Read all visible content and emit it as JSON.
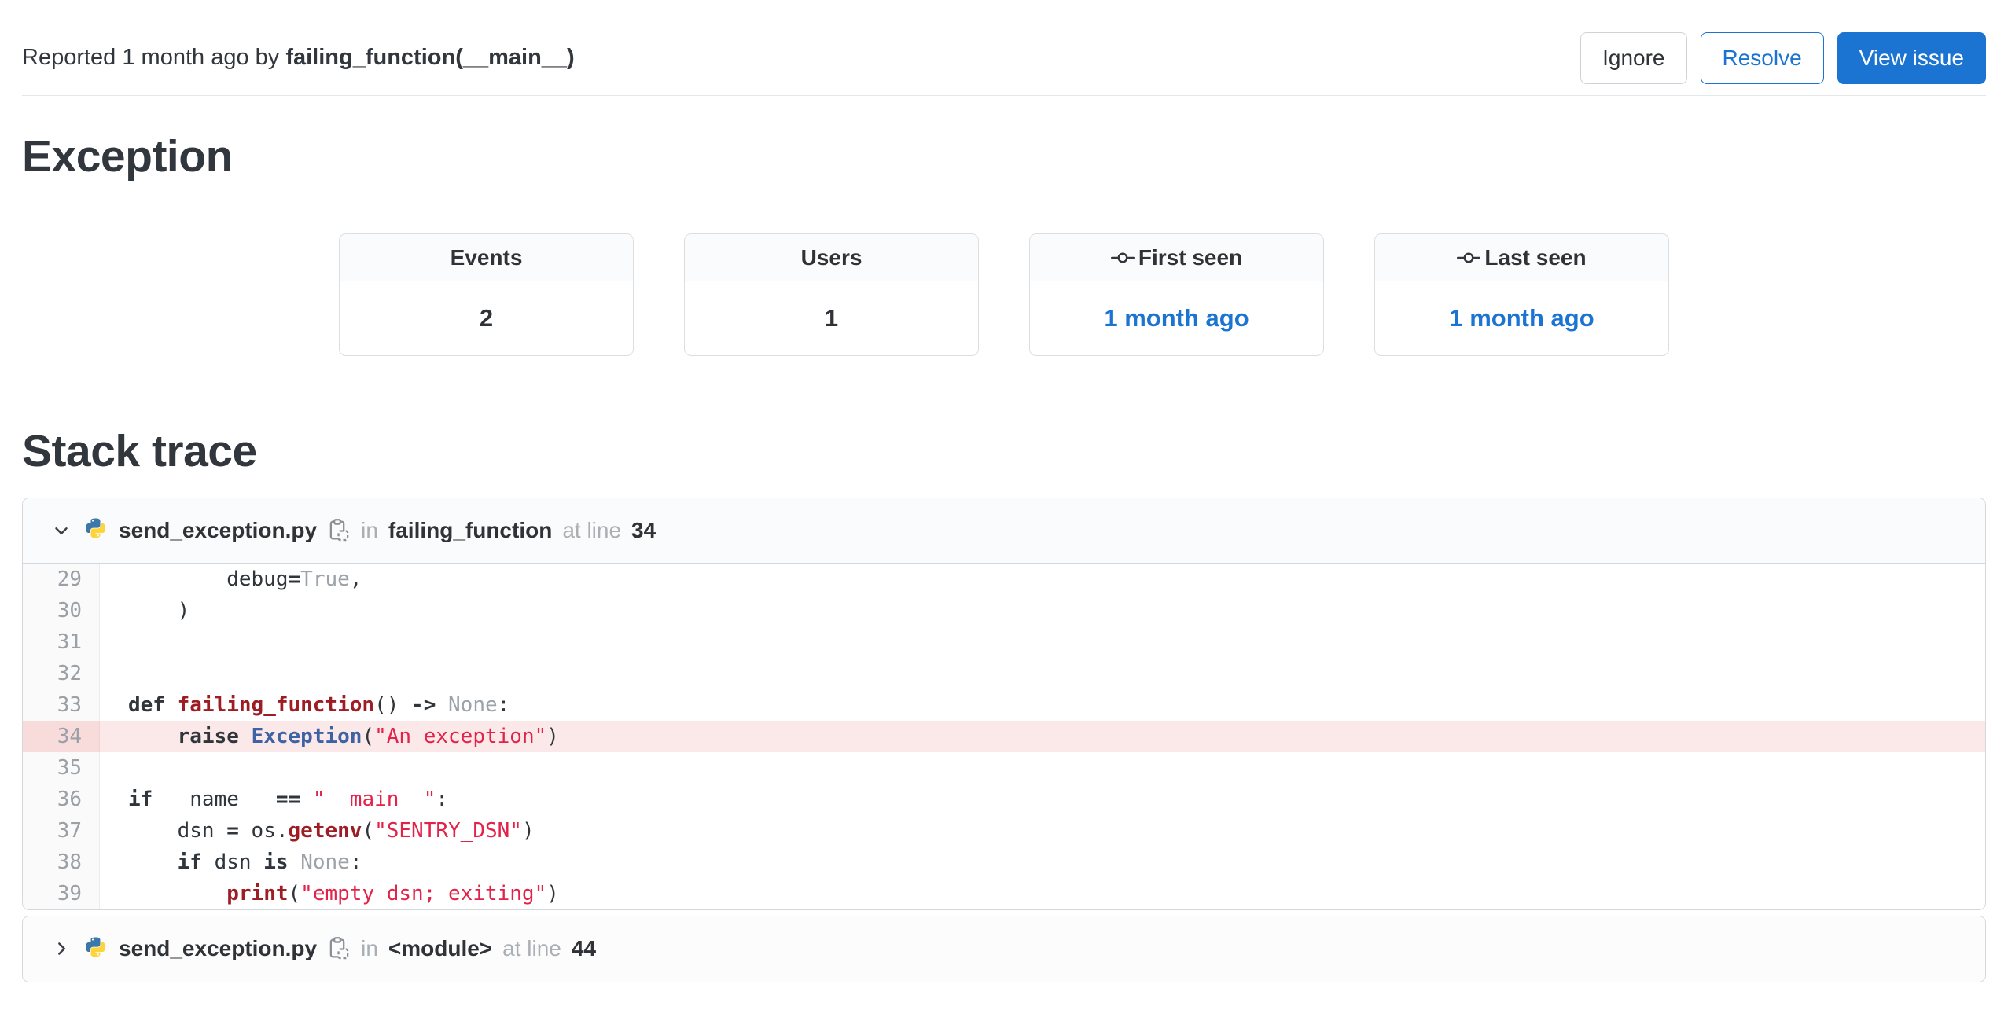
{
  "colors": {
    "accent_blue": "#1b74d1",
    "string_red": "#e32249",
    "function_maroon": "#9e1d24",
    "builtin_blue": "#3e63a4",
    "highlight_row_bg": "#fbe9e9",
    "panel_header_bg": "#fafbfc"
  },
  "topbar": {
    "reported_text": "Reported 1 month ago by ",
    "culprit": "failing_function(__main__)",
    "ignore_label": "Ignore",
    "resolve_label": "Resolve",
    "view_issue_label": "View issue"
  },
  "headings": {
    "exception": "Exception",
    "stack_trace": "Stack trace"
  },
  "stats": {
    "events_label": "Events",
    "events_value": "2",
    "users_label": "Users",
    "users_value": "1",
    "first_seen_label": "First seen",
    "first_seen_value": "1 month ago",
    "last_seen_label": "Last seen",
    "last_seen_value": "1 month ago"
  },
  "trace": {
    "frames": [
      {
        "filename": "send_exception.py",
        "in_label": "in",
        "function": "failing_function",
        "at_label": "at line",
        "line": "34",
        "expanded": true,
        "lines": [
          {
            "n": "29",
            "hl": false,
            "tokens": [
              {
                "t": "p",
                "v": "        debug"
              },
              {
                "t": "k",
                "v": "="
              },
              {
                "t": "l",
                "v": "True"
              },
              {
                "t": "p",
                "v": ","
              }
            ]
          },
          {
            "n": "30",
            "hl": false,
            "tokens": [
              {
                "t": "p",
                "v": "    )"
              }
            ]
          },
          {
            "n": "31",
            "hl": false,
            "tokens": []
          },
          {
            "n": "32",
            "hl": false,
            "tokens": []
          },
          {
            "n": "33",
            "hl": false,
            "tokens": [
              {
                "t": "k",
                "v": "def"
              },
              {
                "t": "p",
                "v": " "
              },
              {
                "t": "f",
                "v": "failing_function"
              },
              {
                "t": "p",
                "v": "() "
              },
              {
                "t": "k",
                "v": "->"
              },
              {
                "t": "p",
                "v": " "
              },
              {
                "t": "l",
                "v": "None"
              },
              {
                "t": "p",
                "v": ":"
              }
            ]
          },
          {
            "n": "34",
            "hl": true,
            "tokens": [
              {
                "t": "p",
                "v": "    "
              },
              {
                "t": "k",
                "v": "raise"
              },
              {
                "t": "p",
                "v": " "
              },
              {
                "t": "b",
                "v": "Exception"
              },
              {
                "t": "p",
                "v": "("
              },
              {
                "t": "s",
                "v": "\"An exception\""
              },
              {
                "t": "p",
                "v": ")"
              }
            ]
          },
          {
            "n": "35",
            "hl": false,
            "tokens": []
          },
          {
            "n": "36",
            "hl": false,
            "tokens": [
              {
                "t": "k",
                "v": "if"
              },
              {
                "t": "p",
                "v": " __name__ "
              },
              {
                "t": "k",
                "v": "=="
              },
              {
                "t": "p",
                "v": " "
              },
              {
                "t": "s",
                "v": "\"__main__\""
              },
              {
                "t": "p",
                "v": ":"
              }
            ]
          },
          {
            "n": "37",
            "hl": false,
            "tokens": [
              {
                "t": "p",
                "v": "    dsn "
              },
              {
                "t": "k",
                "v": "="
              },
              {
                "t": "p",
                "v": " os."
              },
              {
                "t": "f",
                "v": "getenv"
              },
              {
                "t": "p",
                "v": "("
              },
              {
                "t": "s",
                "v": "\"SENTRY_DSN\""
              },
              {
                "t": "p",
                "v": ")"
              }
            ]
          },
          {
            "n": "38",
            "hl": false,
            "tokens": [
              {
                "t": "p",
                "v": "    "
              },
              {
                "t": "k",
                "v": "if"
              },
              {
                "t": "p",
                "v": " dsn "
              },
              {
                "t": "k",
                "v": "is"
              },
              {
                "t": "p",
                "v": " "
              },
              {
                "t": "l",
                "v": "None"
              },
              {
                "t": "p",
                "v": ":"
              }
            ]
          },
          {
            "n": "39",
            "hl": false,
            "tokens": [
              {
                "t": "p",
                "v": "        "
              },
              {
                "t": "f",
                "v": "print"
              },
              {
                "t": "p",
                "v": "("
              },
              {
                "t": "s",
                "v": "\"empty dsn; exiting\""
              },
              {
                "t": "p",
                "v": ")"
              }
            ]
          }
        ]
      },
      {
        "filename": "send_exception.py",
        "in_label": "in",
        "function": "<module>",
        "at_label": "at line",
        "line": "44",
        "expanded": false,
        "lines": []
      }
    ]
  }
}
